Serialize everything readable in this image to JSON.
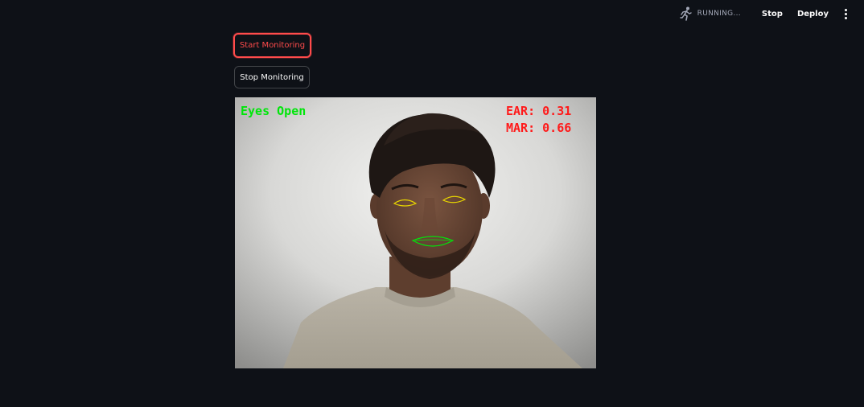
{
  "header": {
    "status_text": "RUNNING...",
    "status_icon": "running-person-icon",
    "stop_label": "Stop",
    "deploy_label": "Deploy",
    "menu_icon": "vertical-dots-icon"
  },
  "controls": {
    "start_label": "Start Monitoring",
    "stop_label": "Stop Monitoring"
  },
  "video": {
    "eyes_status": "Eyes Open",
    "ear_text": "EAR: 0.31",
    "mar_text": "MAR: 0.66"
  },
  "colors": {
    "background": "#0e1117",
    "accent_red": "#ff4b4b",
    "overlay_green": "#00e60a",
    "overlay_red": "#ff1a1a",
    "eye_contour": "#e6d400",
    "mouth_contour": "#00e60a"
  }
}
